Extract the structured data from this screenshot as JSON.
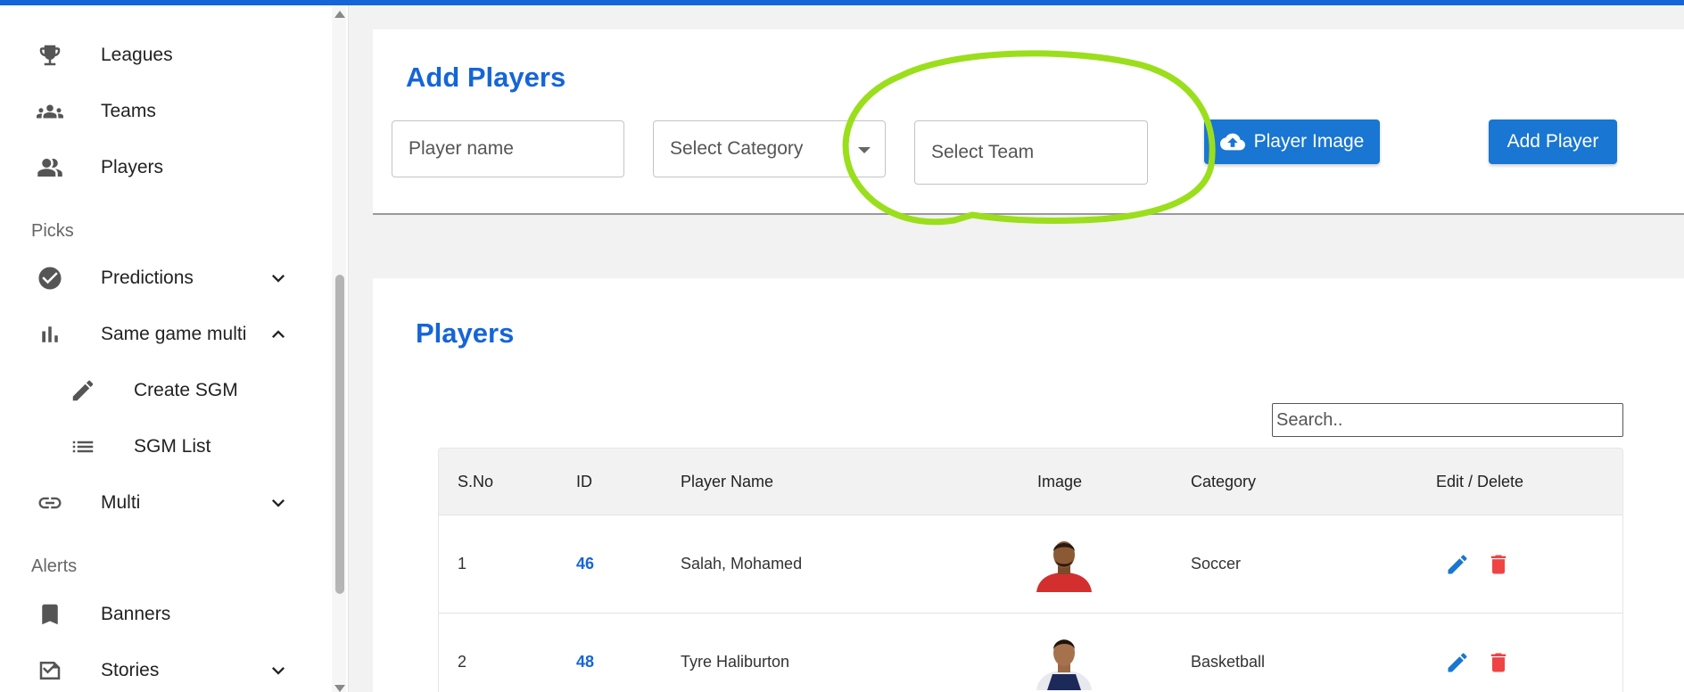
{
  "sidebar": {
    "items": [
      {
        "label": "Leagues",
        "icon": "trophy-icon"
      },
      {
        "label": "Teams",
        "icon": "groups-icon"
      },
      {
        "label": "Players",
        "icon": "people-icon"
      }
    ],
    "section_picks": "Picks",
    "picks": [
      {
        "label": "Predictions",
        "icon": "check-circle-icon",
        "chevron": "chevron-down-icon"
      },
      {
        "label": "Same game multi",
        "icon": "bar-chart-icon",
        "chevron": "chevron-up-icon"
      },
      {
        "label": "Create SGM",
        "icon": "pencil-icon"
      },
      {
        "label": "SGM List",
        "icon": "list-icon"
      },
      {
        "label": "Multi",
        "icon": "link-icon",
        "chevron": "chevron-down-icon"
      }
    ],
    "section_alerts": "Alerts",
    "alerts": [
      {
        "label": "Banners",
        "icon": "bookmark-icon"
      },
      {
        "label": "Stories",
        "icon": "stories-icon",
        "chevron": "chevron-down-icon"
      }
    ]
  },
  "add_form": {
    "title": "Add Players",
    "player_name_placeholder": "Player name",
    "category_placeholder": "Select Category",
    "team_placeholder": "Select Team",
    "image_button": "Player Image",
    "add_button": "Add Player"
  },
  "players": {
    "title": "Players",
    "search_placeholder": "Search..",
    "columns": [
      "S.No",
      "ID",
      "Player Name",
      "Image",
      "Category",
      "Edit / Delete"
    ],
    "rows": [
      {
        "sno": "1",
        "id": "46",
        "name": "Salah, Mohamed",
        "category": "Soccer"
      },
      {
        "sno": "2",
        "id": "48",
        "name": "Tyre Haliburton",
        "category": "Basketball"
      }
    ]
  },
  "colors": {
    "accent": "#1565d8",
    "button": "#1976d2",
    "delete": "#ef4444",
    "annotation": "#9bde1c"
  }
}
